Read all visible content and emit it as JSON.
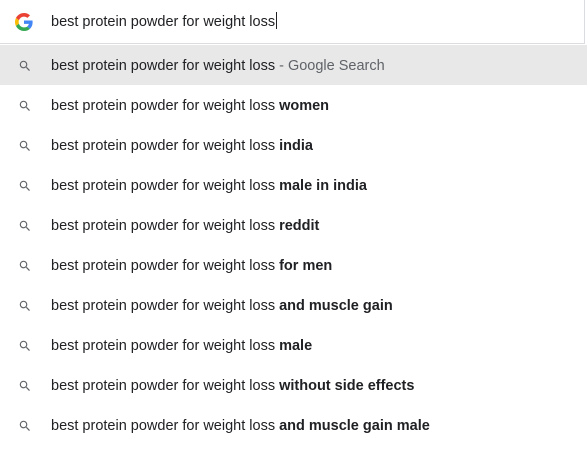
{
  "omnibox": {
    "value": "best protein powder for weight loss",
    "logo_icon": "google-g-icon"
  },
  "colors": {
    "selected_row": "#e8e8e9",
    "text": "#202124",
    "secondary_text": "#5f6368",
    "icon": "#5f6368"
  },
  "suggestions": [
    {
      "base": "best protein powder for weight loss",
      "bold": "",
      "secondary": " - Google Search",
      "icon": "search-icon",
      "selected": true
    },
    {
      "base": "best protein powder for weight loss ",
      "bold": "women",
      "secondary": "",
      "icon": "search-icon"
    },
    {
      "base": "best protein powder for weight loss ",
      "bold": "india",
      "secondary": "",
      "icon": "search-icon"
    },
    {
      "base": "best protein powder for weight loss ",
      "bold": "male in india",
      "secondary": "",
      "icon": "search-icon"
    },
    {
      "base": "best protein powder for weight loss ",
      "bold": "reddit",
      "secondary": "",
      "icon": "search-icon"
    },
    {
      "base": "best protein powder for weight loss ",
      "bold": "for men",
      "secondary": "",
      "icon": "search-icon"
    },
    {
      "base": "best protein powder for weight loss ",
      "bold": "and muscle gain",
      "secondary": "",
      "icon": "search-icon"
    },
    {
      "base": "best protein powder for weight loss ",
      "bold": "male",
      "secondary": "",
      "icon": "search-icon"
    },
    {
      "base": "best protein powder for weight loss ",
      "bold": "without side effects",
      "secondary": "",
      "icon": "search-icon"
    },
    {
      "base": "best protein powder for weight loss ",
      "bold": "and muscle gain male",
      "secondary": "",
      "icon": "search-icon"
    }
  ]
}
